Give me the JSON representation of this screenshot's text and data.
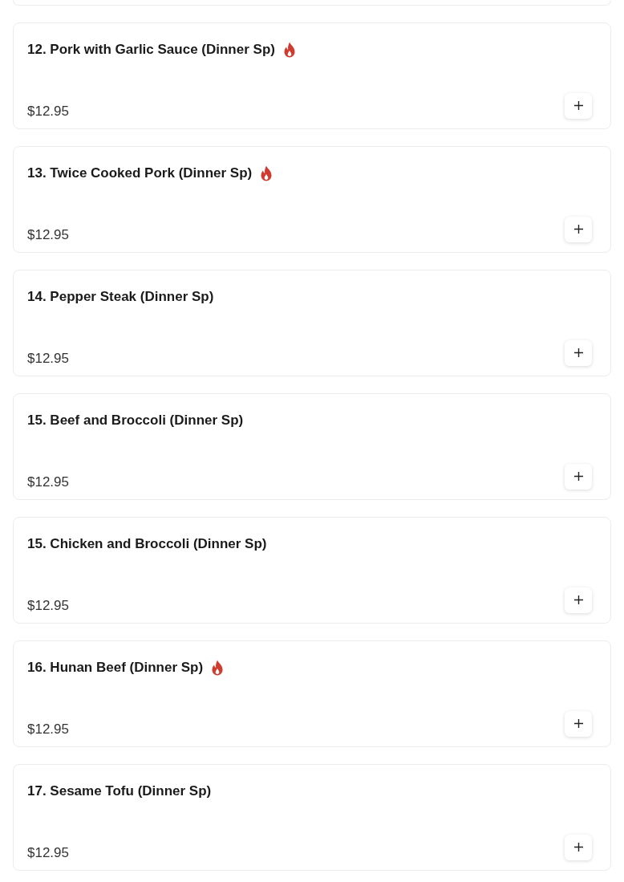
{
  "items": [
    {
      "name": "12. Pork with Garlic Sauce (Dinner Sp)",
      "spicy": true,
      "price": "$12.95"
    },
    {
      "name": "13. Twice Cooked Pork (Dinner Sp)",
      "spicy": true,
      "price": "$12.95"
    },
    {
      "name": "14. Pepper Steak (Dinner Sp)",
      "spicy": false,
      "price": "$12.95"
    },
    {
      "name": "15. Beef and Broccoli (Dinner Sp)",
      "spicy": false,
      "price": "$12.95"
    },
    {
      "name": "15. Chicken and Broccoli (Dinner Sp)",
      "spicy": false,
      "price": "$12.95"
    },
    {
      "name": "16. Hunan Beef (Dinner Sp)",
      "spicy": true,
      "price": "$12.95"
    },
    {
      "name": "17. Sesame Tofu (Dinner Sp)",
      "spicy": false,
      "price": "$12.95"
    }
  ]
}
